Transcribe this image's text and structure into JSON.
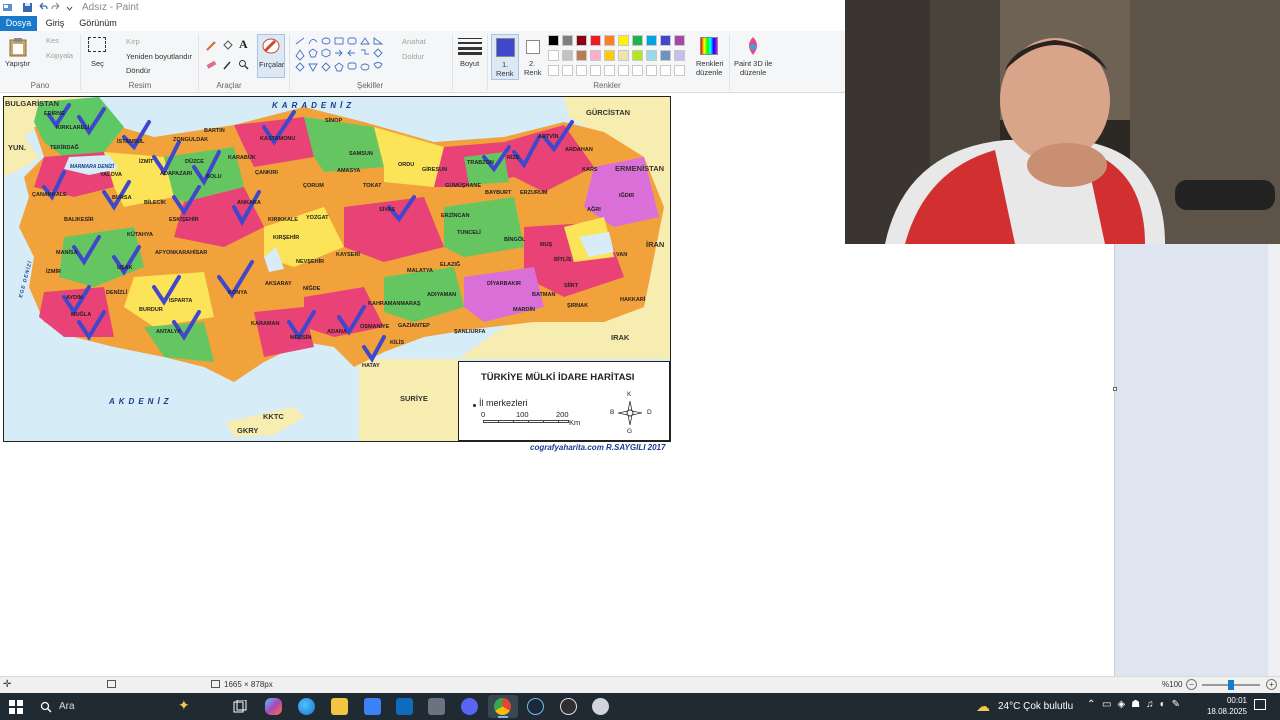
{
  "window": {
    "title": "Adsız - Paint"
  },
  "tabs": [
    {
      "label": "Dosya",
      "active": true
    },
    {
      "label": "Giriş",
      "active": false
    },
    {
      "label": "Görünüm",
      "active": false
    }
  ],
  "ribbon": {
    "clipboard": {
      "paste": "Yapıştır",
      "cut": "Kes",
      "copy": "Kopyala",
      "group": "Pano"
    },
    "image": {
      "select": "Seç",
      "crop": "Kırp",
      "resize": "Yeniden boyutlandır",
      "rotate": "Döndür",
      "group": "Resim"
    },
    "tools": {
      "group": "Araçlar"
    },
    "brushes": {
      "label": "Fırçalar"
    },
    "shapes": {
      "outline": "Anahat",
      "fill": "Doldur",
      "group": "Şekiller"
    },
    "size": {
      "label": "Boyut"
    },
    "color1": {
      "label": "1.",
      "label2": "Renk"
    },
    "color2": {
      "label": "2.",
      "label2": "Renk"
    },
    "edit_colors": {
      "label": "Renkleri",
      "label2": "düzenle"
    },
    "paint3d": {
      "label": "Paint 3D ile",
      "label2": "düzenle"
    },
    "colors_group": "Renkler",
    "palette": [
      "#000000",
      "#7f7f7f",
      "#880015",
      "#ed1c24",
      "#ff7f27",
      "#fff200",
      "#22b14c",
      "#00a2e8",
      "#3f48cc",
      "#a349a4",
      "#ffffff",
      "#c3c3c3",
      "#b97a57",
      "#ffaec9",
      "#ffc90e",
      "#efe4b0",
      "#b5e61d",
      "#99d9ea",
      "#7092be",
      "#c8bfe7"
    ],
    "primary_color": "#3f48cc",
    "secondary_color": "#ffffff"
  },
  "map": {
    "title": "TÜRKİYE MÜLKİ İDARE HARİTASI",
    "legend_item": "İl merkezleri",
    "scale": {
      "s0": "0",
      "s1": "100",
      "s2": "200",
      "unit": "Km"
    },
    "compass": {
      "n": "K",
      "s": "G",
      "e": "D",
      "w": "B"
    },
    "credit": "cografyaharita.com  R.SAYGILI 2017",
    "seas": {
      "north": "KARADENİZ",
      "south": "AKDENİZ",
      "west": "EGE DENİZİ",
      "marmara": "MARMARA DENİZİ"
    },
    "countries": {
      "bulgaria": "BULGARİSTAN",
      "greece": "YUN.",
      "georgia": "GÜRCİSTAN",
      "armenia": "ERMENİSTAN",
      "iran": "İRAN",
      "iraq": "IRAK",
      "syria": "SURİYE",
      "kktc": "KKTC",
      "gkry": "GKRY"
    },
    "provinces": [
      "EDİRNE",
      "KIRKLARELİ",
      "TEKİRDAĞ",
      "İSTANBUL",
      "YALOVA",
      "İZMİT",
      "ÇANAKKALE",
      "BURSA",
      "BİLECİK",
      "BALIKESİR",
      "KÜTAHYA",
      "MANİSA",
      "İZMİR",
      "UŞAK",
      "AYDIN",
      "DENİZLİ",
      "MUĞLA",
      "BURDUR",
      "ISPARTA",
      "ANTALYA",
      "AFYONKARAHİSAR",
      "ESKİŞEHİR",
      "ZONGULDAK",
      "BARTIN",
      "KARABÜK",
      "DÜZCE",
      "ADAPAZARI",
      "BOLU",
      "ANKARA",
      "KASTAMONU",
      "SİNOP",
      "ÇANKIRI",
      "ÇORUM",
      "SAMSUN",
      "AMASYA",
      "TOKAT",
      "ORDU",
      "GİRESUN",
      "TRABZON",
      "RİZE",
      "ARTVİN",
      "ARDAHAN",
      "KARS",
      "IĞDIR",
      "AĞRI",
      "ERZURUM",
      "BAYBURT",
      "GÜMÜŞHANE",
      "ERZİNCAN",
      "SİVAS",
      "YOZGAT",
      "KIRIKKALE",
      "KIRŞEHİR",
      "NEVŞEHİR",
      "KAYSERİ",
      "AKSARAY",
      "NİĞDE",
      "KONYA",
      "KARAMAN",
      "MERSİN",
      "ADANA",
      "OSMANİYE",
      "HATAY",
      "KİLİS",
      "GAZİANTEP",
      "ŞANLIURFA",
      "KAHRAMANMARAŞ",
      "ADIYAMAN",
      "MALATYA",
      "ELAZIĞ",
      "TUNCELİ",
      "BİNGÖL",
      "MUŞ",
      "BİTLİS",
      "VAN",
      "HAKKARİ",
      "ŞIRNAK",
      "SİİRT",
      "BATMAN",
      "MARDİN",
      "DİYARBAKIR"
    ]
  },
  "status": {
    "image_size": "1665 × 878px",
    "zoom": "%100"
  },
  "taskbar": {
    "search_placeholder": "Ara",
    "weather": "24°C  Çok bulutlu",
    "time": "00:01",
    "date": "18.08.2025"
  }
}
